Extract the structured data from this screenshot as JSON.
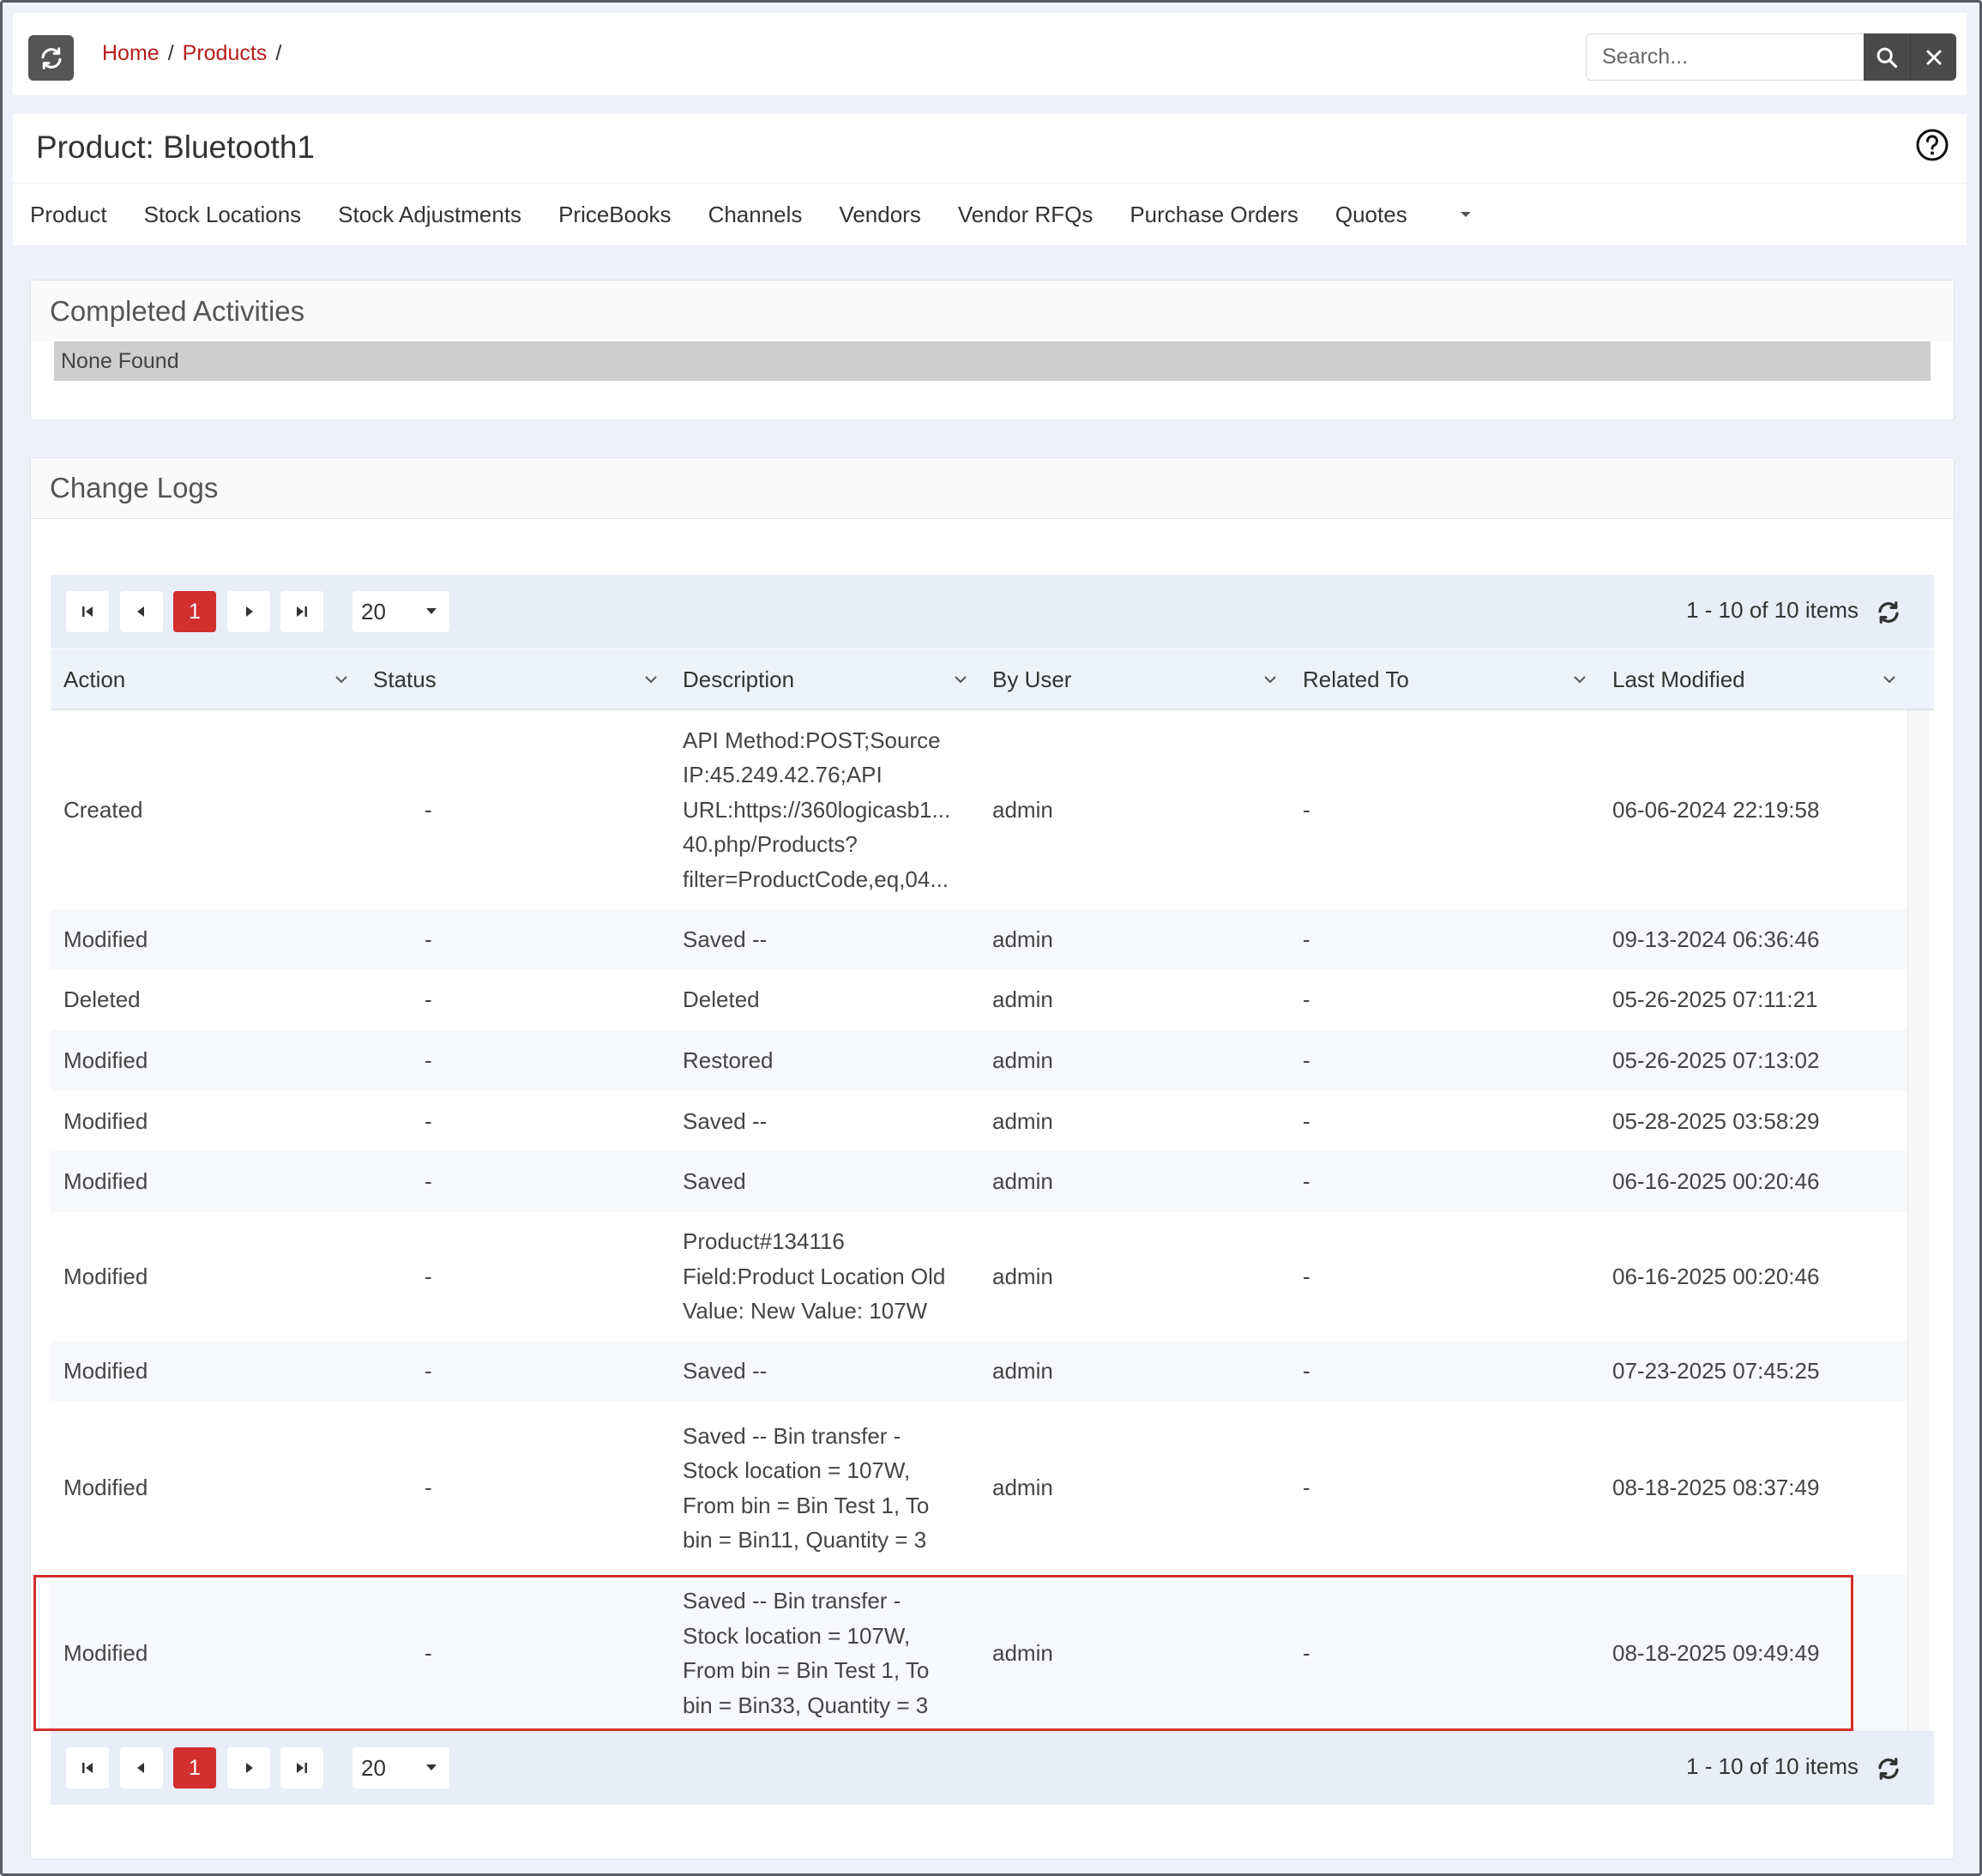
{
  "breadcrumb": {
    "home": "Home",
    "products": "Products",
    "sep": "/"
  },
  "search": {
    "placeholder": "Search..."
  },
  "page": {
    "title": "Product: Bluetooth1"
  },
  "tabs": [
    "Product",
    "Stock Locations",
    "Stock Adjustments",
    "PriceBooks",
    "Channels",
    "Vendors",
    "Vendor RFQs",
    "Purchase Orders",
    "Quotes"
  ],
  "completed": {
    "title": "Completed Activities",
    "empty": "None Found"
  },
  "changelogs": {
    "title": "Change Logs",
    "pager": {
      "current": "1",
      "page_size": "20",
      "info": "1 - 10 of 10 items"
    },
    "columns": [
      "Action",
      "Status",
      "Description",
      "By User",
      "Related To",
      "Last Modified"
    ],
    "rows": [
      {
        "action": "Created",
        "status": "-",
        "description": [
          "API Method:POST;Source",
          "IP:45.249.42.76;API",
          "URL:https://360logicasb1...",
          "40.php/Products?",
          "filter=ProductCode,eq,04..."
        ],
        "user": "admin",
        "related": "-",
        "modified": "06-06-2024 22:19:58"
      },
      {
        "action": "Modified",
        "status": "-",
        "description": [
          "Saved --"
        ],
        "user": "admin",
        "related": "-",
        "modified": "09-13-2024 06:36:46"
      },
      {
        "action": "Deleted",
        "status": "-",
        "description": [
          "Deleted"
        ],
        "user": "admin",
        "related": "-",
        "modified": "05-26-2025 07:11:21"
      },
      {
        "action": "Modified",
        "status": "-",
        "description": [
          "Restored"
        ],
        "user": "admin",
        "related": "-",
        "modified": "05-26-2025 07:13:02"
      },
      {
        "action": "Modified",
        "status": "-",
        "description": [
          "Saved --"
        ],
        "user": "admin",
        "related": "-",
        "modified": "05-28-2025 03:58:29"
      },
      {
        "action": "Modified",
        "status": "-",
        "description": [
          "Saved"
        ],
        "user": "admin",
        "related": "-",
        "modified": "06-16-2025 00:20:46"
      },
      {
        "action": "Modified",
        "status": "-",
        "description": [
          "Product#134116",
          "Field:Product Location Old",
          "Value: New Value: 107W"
        ],
        "user": "admin",
        "related": "-",
        "modified": "06-16-2025 00:20:46"
      },
      {
        "action": "Modified",
        "status": "-",
        "description": [
          "Saved --"
        ],
        "user": "admin",
        "related": "-",
        "modified": "07-23-2025 07:45:25"
      },
      {
        "action": "Modified",
        "status": "-",
        "description": [
          "Saved -- Bin transfer -",
          "Stock location = 107W,",
          "From bin = Bin Test 1, To",
          "bin = Bin11, Quantity = 3"
        ],
        "user": "admin",
        "related": "-",
        "modified": "08-18-2025 08:37:49"
      },
      {
        "action": "Modified",
        "status": "-",
        "description": [
          "Saved -- Bin transfer -",
          "Stock location = 107W,",
          "From bin = Bin Test 1, To",
          "bin = Bin33, Quantity = 3"
        ],
        "user": "admin",
        "related": "-",
        "modified": "08-18-2025 09:49:49"
      }
    ]
  },
  "colors": {
    "accent": "#d32f2f",
    "link": "#b71c1c",
    "toolbar_dark": "#4a4a4a"
  },
  "icons": {
    "refresh": "refresh-icon",
    "search": "search-icon",
    "clear": "close-icon",
    "help": "help-circle-icon"
  }
}
